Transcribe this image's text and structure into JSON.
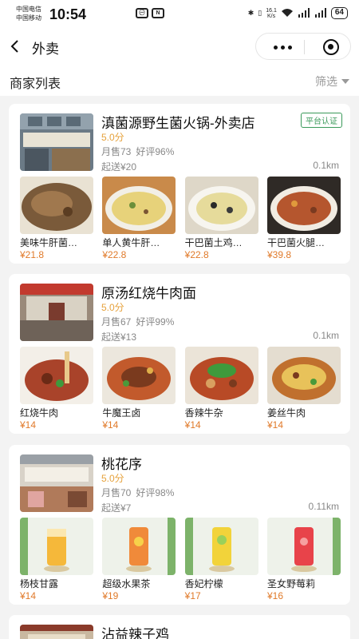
{
  "status_bar": {
    "carrier1": "中国电信",
    "carrier2": "中国移动",
    "time": "10:54",
    "net_speed_top": "16.1",
    "net_speed_unit": "K/s",
    "battery": "64"
  },
  "nav": {
    "title": "外卖"
  },
  "list_header": {
    "title": "商家列表",
    "filter": "筛选"
  },
  "shops": [
    {
      "name": "滇菌源野生菌火锅-外卖店",
      "badge": "平台认证",
      "score": "5.0分",
      "monthly_sales": "月售73",
      "rating": "好评96%",
      "min_order": "起送¥20",
      "distance": "0.1km",
      "dishes": [
        {
          "name": "美味牛肝菌…",
          "price": "¥21.8"
        },
        {
          "name": "单人黄牛肝…",
          "price": "¥22.8"
        },
        {
          "name": "干巴菌土鸡…",
          "price": "¥22.8"
        },
        {
          "name": "干巴菌火腿…",
          "price": "¥39.8"
        }
      ]
    },
    {
      "name": "原汤红烧牛肉面",
      "badge": "",
      "score": "5.0分",
      "monthly_sales": "月售67",
      "rating": "好评99%",
      "min_order": "起送¥13",
      "distance": "0.1km",
      "dishes": [
        {
          "name": "红烧牛肉",
          "price": "¥14"
        },
        {
          "name": "牛魔王卤",
          "price": "¥14"
        },
        {
          "name": "香辣牛杂",
          "price": "¥14"
        },
        {
          "name": "姜丝牛肉",
          "price": "¥14"
        }
      ]
    },
    {
      "name": "桃花序",
      "badge": "",
      "score": "5.0分",
      "monthly_sales": "月售70",
      "rating": "好评98%",
      "min_order": "起送¥7",
      "distance": "0.11km",
      "dishes": [
        {
          "name": "杨枝甘露",
          "price": "¥14"
        },
        {
          "name": "超级水果茶",
          "price": "¥19"
        },
        {
          "name": "香妃柠檬",
          "price": "¥17"
        },
        {
          "name": "圣女野莓莉",
          "price": "¥16"
        }
      ]
    },
    {
      "name": "沾益辣子鸡"
    }
  ],
  "colors": {
    "score": "#e6a23c",
    "price": "#e07a2a",
    "badge": "#3a9a5a"
  }
}
